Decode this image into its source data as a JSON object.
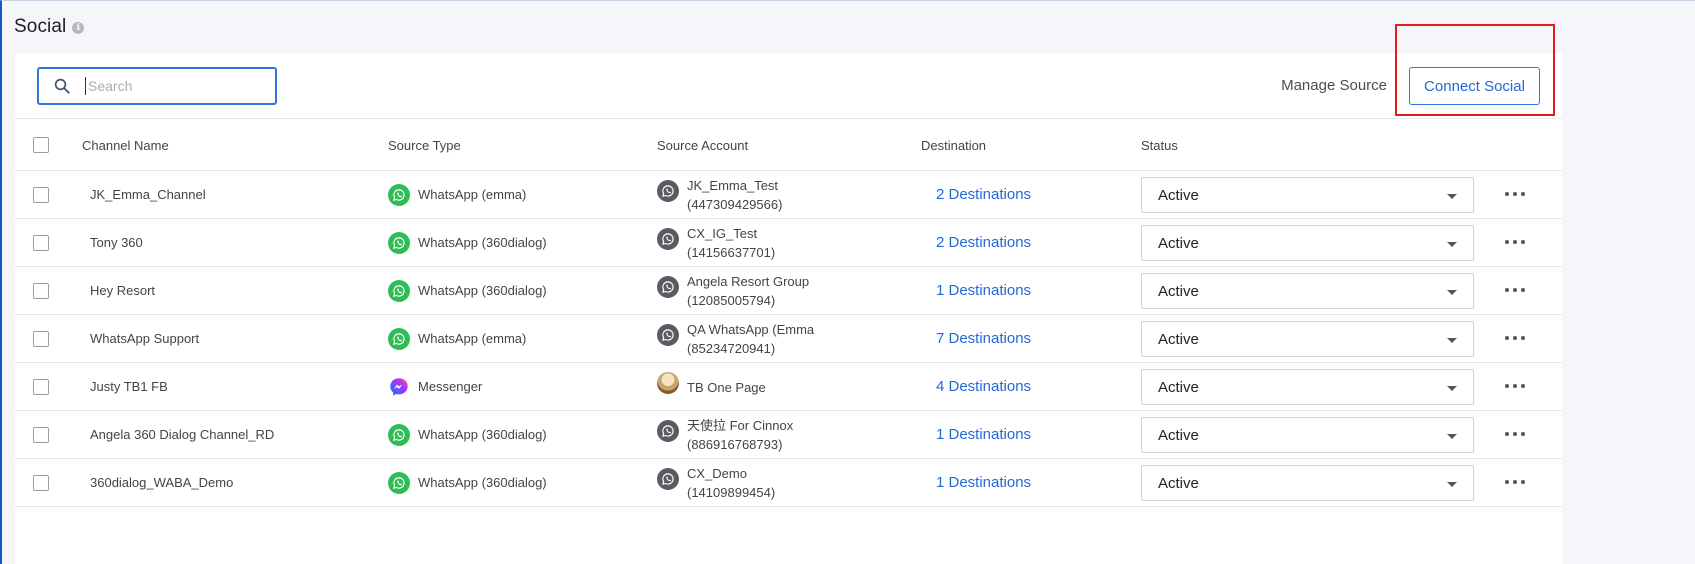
{
  "page": {
    "title": "Social"
  },
  "toolbar": {
    "search_placeholder": "Search",
    "manage_source_label": "Manage Source",
    "connect_social_label": "Connect Social"
  },
  "columns": {
    "channel_name": "Channel Name",
    "source_type": "Source Type",
    "source_account": "Source Account",
    "destination": "Destination",
    "status": "Status"
  },
  "rows": [
    {
      "channel": "JK_Emma_Channel",
      "source_icon": "whatsapp-icon",
      "source_type": "WhatsApp (emma)",
      "account_name": "JK_Emma_Test",
      "account_number": "(447309429566)",
      "account_icon": "account-avatar-icon",
      "destination": "2 Destinations",
      "status": "Active"
    },
    {
      "channel": "Tony 360",
      "source_icon": "whatsapp-icon",
      "source_type": "WhatsApp (360dialog)",
      "account_name": "CX_IG_Test",
      "account_number": "(14156637701)",
      "account_icon": "account-avatar-icon",
      "destination": "2 Destinations",
      "status": "Active"
    },
    {
      "channel": "Hey Resort",
      "source_icon": "whatsapp-icon",
      "source_type": "WhatsApp (360dialog)",
      "account_name": "Angela Resort Group",
      "account_number": "(12085005794)",
      "account_icon": "account-avatar-icon",
      "destination": "1 Destinations",
      "status": "Active"
    },
    {
      "channel": "WhatsApp Support",
      "source_icon": "whatsapp-icon",
      "source_type": "WhatsApp (emma)",
      "account_name": "QA WhatsApp (Emma",
      "account_number": "(85234720941)",
      "account_icon": "account-avatar-icon",
      "destination": "7 Destinations",
      "status": "Active"
    },
    {
      "channel": "Justy TB1 FB",
      "source_icon": "messenger-icon",
      "source_type": "Messenger",
      "account_name": "TB One Page",
      "account_number": "",
      "account_icon": "page-photo-avatar",
      "destination": "4 Destinations",
      "status": "Active"
    },
    {
      "channel": "Angela 360 Dialog Channel_RD",
      "source_icon": "whatsapp-icon",
      "source_type": "WhatsApp (360dialog)",
      "account_name": "天使拉 For Cinnox",
      "account_number": "(886916768793)",
      "account_icon": "account-avatar-icon",
      "destination": "1 Destinations",
      "status": "Active"
    },
    {
      "channel": "360dialog_WABA_Demo",
      "source_icon": "whatsapp-icon",
      "source_type": "WhatsApp (360dialog)",
      "account_name": "CX_Demo",
      "account_number": "(14109899454)",
      "account_icon": "account-avatar-icon",
      "destination": "1 Destinations",
      "status": "Active"
    }
  ],
  "colors": {
    "accent": "#2369d6",
    "whatsapp": "#2fbd55",
    "highlight": "#e21b1b"
  }
}
